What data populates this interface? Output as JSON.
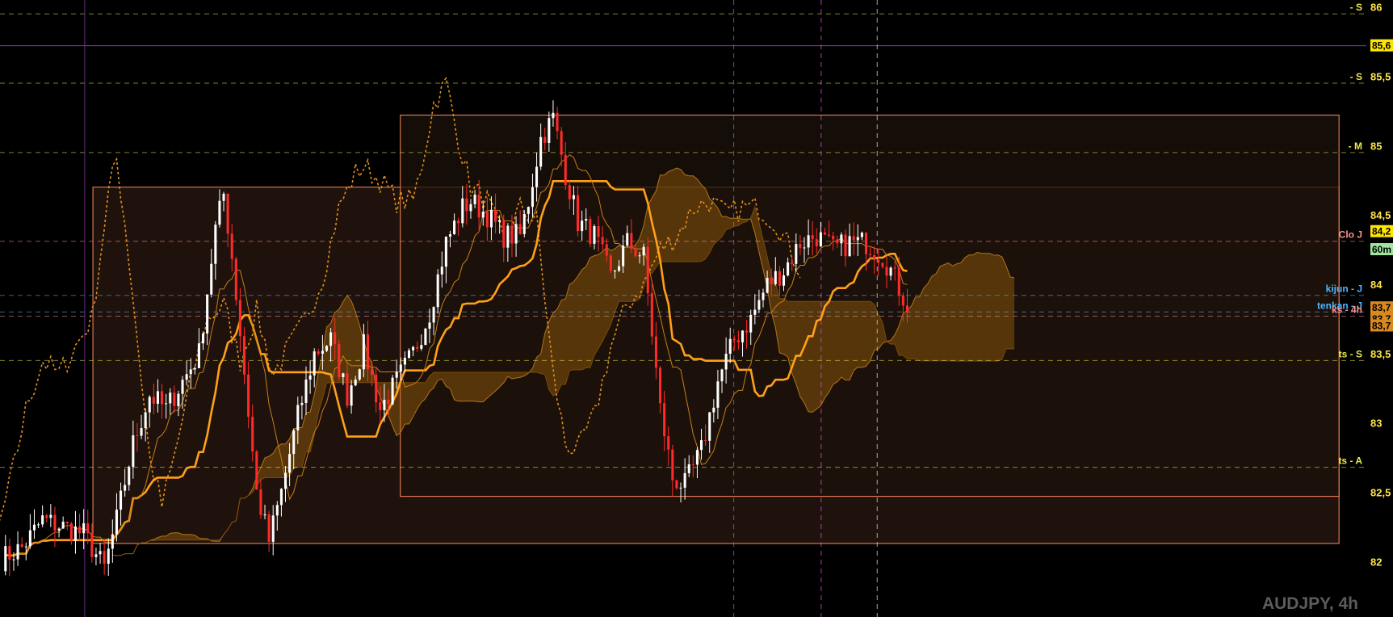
{
  "chart_data": {
    "type": "candlestick",
    "symbol": "AUDJPY, 4h",
    "price_scale": {
      "ylim": [
        81.6,
        86.05
      ],
      "tick_labels": [
        "86",
        "85,5",
        "85",
        "84,5",
        "84",
        "83,5",
        "83",
        "82,5",
        "82"
      ],
      "tick_values": [
        86,
        85.5,
        85,
        84.5,
        84,
        83.5,
        83,
        82.5,
        82
      ]
    },
    "price_tags": [
      {
        "text": "85,6",
        "price": 85.72,
        "bg": "#ffe600",
        "fg": "#000000"
      },
      {
        "text": "84,2",
        "price": 84.38,
        "bg": "#ffe600",
        "fg": "#000000"
      },
      {
        "text": "60m",
        "price": 84.25,
        "bg": "#9fe59f",
        "fg": "#000000"
      },
      {
        "text": "83,7",
        "price": 83.83,
        "bg": "#d98a1f",
        "fg": "#000000"
      },
      {
        "text": "83,7",
        "price": 83.75,
        "bg": "#d98a1f",
        "fg": "#000000"
      },
      {
        "text": "83,7",
        "price": 83.7,
        "bg": "#d98a1f",
        "fg": "#000000"
      }
    ],
    "level_labels": [
      {
        "text": "- S",
        "price": 85.95,
        "color": "#e8e84a"
      },
      {
        "text": "- S",
        "price": 85.45,
        "color": "#e8e84a"
      },
      {
        "text": "- M",
        "price": 84.95,
        "color": "#e8e84a"
      },
      {
        "text": "Clo J",
        "price": 84.31,
        "color": "#ff9090"
      },
      {
        "text": "kijun - J",
        "price": 83.92,
        "color": "#4db8ff"
      },
      {
        "text": "tenkan - J",
        "price": 83.8,
        "color": "#4db8ff"
      },
      {
        "text": "ks - 4h",
        "price": 83.77,
        "color": "#ff9090"
      },
      {
        "text": "ts - S",
        "price": 83.45,
        "color": "#e8e84a"
      },
      {
        "text": "ts - A",
        "price": 82.68,
        "color": "#e8e84a"
      }
    ],
    "boxes": [
      {
        "start": 0.068,
        "end": 0.98,
        "top": 84.7,
        "bottom": 82.13,
        "fill": "#2a1810"
      },
      {
        "start": 0.293,
        "end": 0.98,
        "top": 85.22,
        "bottom": 82.47,
        "fill": "#1c1109"
      }
    ],
    "vertical_lines": [
      {
        "pos": 0.062,
        "color": "#7c3aa0",
        "dash": "none"
      },
      {
        "pos": 0.537,
        "color": "#4a7bd0",
        "dash": "6,5"
      },
      {
        "pos": 0.601,
        "color": "#cf4fcf",
        "dash": "6,5"
      },
      {
        "pos": 0.642,
        "color": "#c8c8c8",
        "dash": "6,5"
      }
    ],
    "colors": {
      "up": "#ffffff",
      "down": "#ff2a2a",
      "kijun": "#ffa018",
      "chikou": "#e0901a",
      "cloud": "#a66a0d"
    },
    "candle_count": 220,
    "candle_x_range": [
      0.004,
      0.664
    ],
    "price_path": [
      [
        0,
        82.02
      ],
      [
        5,
        82.1
      ],
      [
        10,
        82.3
      ],
      [
        15,
        82.25
      ],
      [
        20,
        82.2
      ],
      [
        25,
        81.95
      ],
      [
        28,
        82.3
      ],
      [
        32,
        82.85
      ],
      [
        36,
        83.2
      ],
      [
        40,
        83.1
      ],
      [
        44,
        83.3
      ],
      [
        48,
        83.5
      ],
      [
        52,
        84.4
      ],
      [
        54,
        84.65
      ],
      [
        56,
        84.2
      ],
      [
        58,
        83.65
      ],
      [
        62,
        82.5
      ],
      [
        65,
        82.15
      ],
      [
        68,
        82.5
      ],
      [
        72,
        83.05
      ],
      [
        76,
        83.5
      ],
      [
        80,
        83.6
      ],
      [
        84,
        83.2
      ],
      [
        88,
        83.55
      ],
      [
        92,
        83.1
      ],
      [
        96,
        83.3
      ],
      [
        100,
        83.5
      ],
      [
        104,
        83.8
      ],
      [
        108,
        84.3
      ],
      [
        112,
        84.55
      ],
      [
        114,
        84.6
      ],
      [
        118,
        84.5
      ],
      [
        122,
        84.35
      ],
      [
        126,
        84.35
      ],
      [
        128,
        84.6
      ],
      [
        131,
        85.05
      ],
      [
        134,
        85.2
      ],
      [
        137,
        84.8
      ],
      [
        140,
        84.45
      ],
      [
        144,
        84.35
      ],
      [
        148,
        84.05
      ],
      [
        152,
        84.3
      ],
      [
        156,
        84.2
      ],
      [
        160,
        83.1
      ],
      [
        163,
        82.6
      ],
      [
        166,
        82.55
      ],
      [
        170,
        82.8
      ],
      [
        174,
        83.3
      ],
      [
        178,
        83.6
      ],
      [
        182,
        83.75
      ],
      [
        186,
        84.0
      ],
      [
        190,
        84.1
      ],
      [
        194,
        84.3
      ],
      [
        198,
        84.35
      ],
      [
        202,
        84.25
      ],
      [
        206,
        84.3
      ],
      [
        210,
        84.3
      ],
      [
        214,
        84.2
      ],
      [
        216,
        84.1
      ],
      [
        220,
        83.85
      ]
    ]
  }
}
